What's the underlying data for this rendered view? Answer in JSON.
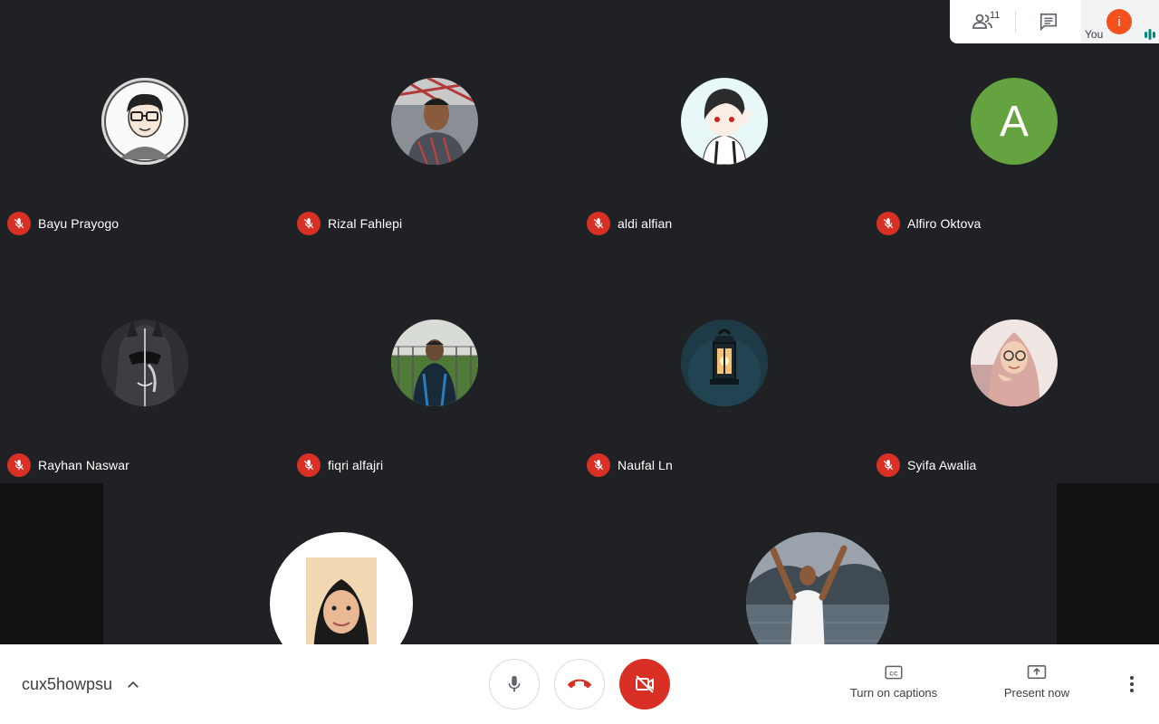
{
  "participants_grid": [
    {
      "name": "Bayu Prayogo",
      "avatar": "cartoon-glasses"
    },
    {
      "name": "Rizal Fahlepi",
      "avatar": "photo-man"
    },
    {
      "name": "aldi alfian",
      "avatar": "anime-boy"
    },
    {
      "name": "Alfiro Oktova",
      "avatar": "letter",
      "initial": "A",
      "color": "#65a340"
    },
    {
      "name": "Rayhan Naswar",
      "avatar": "dark-mask"
    },
    {
      "name": "fiqri alfajri",
      "avatar": "photo-field"
    },
    {
      "name": "Naufal Ln",
      "avatar": "lantern"
    },
    {
      "name": "Syifa Awalia",
      "avatar": "photo-hijab"
    }
  ],
  "bottom_tiles": [
    {
      "avatar": "photo-hijab-portrait"
    },
    {
      "avatar": "photo-lake"
    }
  ],
  "topbar": {
    "people_count": "11",
    "you_label": "You",
    "you_initial": "i",
    "you_color": "#f4511e"
  },
  "bottombar": {
    "meeting_code": "cux5howpsu",
    "captions_label": "Turn on captions",
    "present_label": "Present now"
  },
  "colors": {
    "background": "#202124",
    "muted_badge": "#d93025",
    "camera_off": "#d93025"
  }
}
